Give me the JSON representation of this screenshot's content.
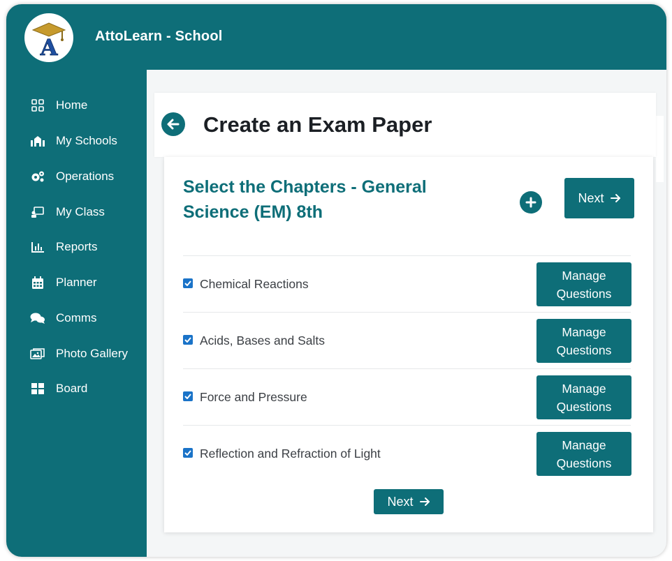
{
  "app": {
    "title": "AttoLearn - School",
    "logo_letter": "A"
  },
  "sidebar": {
    "items": [
      {
        "label": "Home",
        "icon": "grid-icon"
      },
      {
        "label": "My Schools",
        "icon": "school-icon"
      },
      {
        "label": "Operations",
        "icon": "gears-icon"
      },
      {
        "label": "My Class",
        "icon": "classroom-icon"
      },
      {
        "label": "Reports",
        "icon": "bar-chart-icon"
      },
      {
        "label": "Planner",
        "icon": "calendar-icon"
      },
      {
        "label": "Comms",
        "icon": "chat-icon"
      },
      {
        "label": "Photo Gallery",
        "icon": "photos-icon"
      },
      {
        "label": "Board",
        "icon": "board-icon"
      }
    ]
  },
  "header": {
    "title": "Create an Exam Paper"
  },
  "main": {
    "section_title": "Select the Chapters - General Science (EM) 8th",
    "next_label": "Next",
    "chapters": [
      {
        "label": "Chemical Reactions",
        "checked": true
      },
      {
        "label": "Acids, Bases and Salts",
        "checked": true
      },
      {
        "label": "Force and Pressure",
        "checked": true
      },
      {
        "label": "Reflection and Refraction of Light",
        "checked": true
      }
    ],
    "manage_line1": "Manage",
    "manage_line2": "Questions"
  },
  "colors": {
    "primary": "#0e6e78",
    "checkbox": "#1a73c8",
    "title_text": "#1b1f24"
  }
}
